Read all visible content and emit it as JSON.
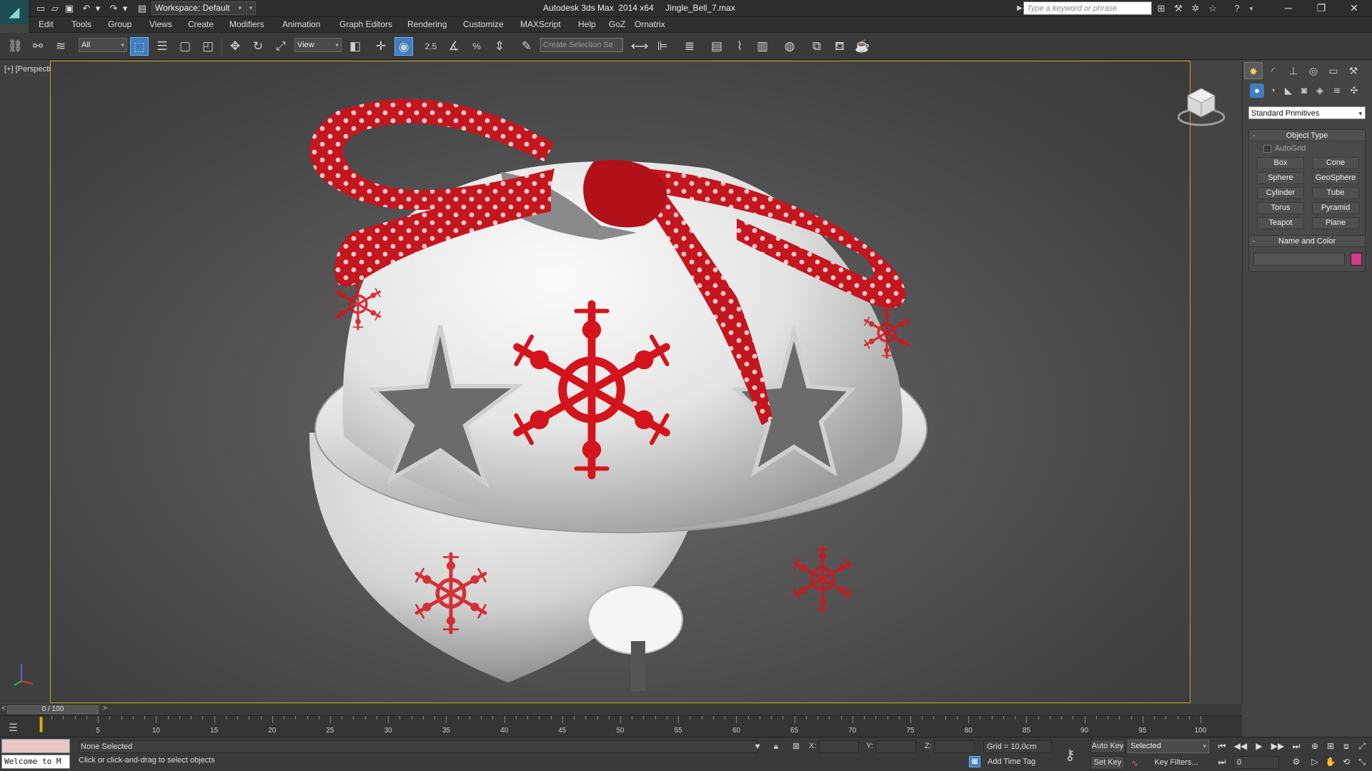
{
  "titlebar": {
    "workspace": "Workspace: Default",
    "title": "Autodesk 3ds Max  2014 x64     Jingle_Bell_7.max",
    "search_placeholder": "Type a keyword or phrase"
  },
  "menu": [
    "Edit",
    "Tools",
    "Group",
    "Views",
    "Create",
    "Modifiers",
    "Animation",
    "Graph Editors",
    "Rendering",
    "Customize",
    "MAXScript",
    "Help",
    "GoZ",
    "Ornatrix"
  ],
  "toolbar": {
    "selection_filter": "All",
    "reference_coord": "View",
    "angle_snap_label": "2.5",
    "named_selection_placeholder": "Create Selection Se"
  },
  "viewport": {
    "label": "[+] [Perspective ] [Shaded ]"
  },
  "command_panel": {
    "category": "Standard Primitives",
    "object_type_title": "Object Type",
    "autogrid": "AutoGrid",
    "primitives": [
      "Box",
      "Cone",
      "Sphere",
      "GeoSphere",
      "Cylinder",
      "Tube",
      "Torus",
      "Pyramid",
      "Teapot",
      "Plane"
    ],
    "name_color_title": "Name and Color",
    "object_color": "#d63a8c"
  },
  "timeline": {
    "slider_label": "0 / 100",
    "ruler_labels": [
      "5",
      "10",
      "15",
      "20",
      "25",
      "30",
      "35",
      "40",
      "45",
      "50",
      "55",
      "60",
      "65",
      "70",
      "75",
      "80",
      "85",
      "90",
      "95",
      "100"
    ]
  },
  "status": {
    "maxscript_output": "Welcome to M",
    "selection": "None Selected",
    "prompt": "Click or click-and-drag to select objects",
    "x_label": "X:",
    "y_label": "Y:",
    "z_label": "Z:",
    "grid": "Grid = 10,0cm",
    "add_time_tag": "Add Time Tag",
    "auto_key": "Auto Key",
    "set_key": "Set Key",
    "key_mode": "Selected",
    "key_filters": "Key Filters...",
    "current_frame": "0"
  },
  "colors": {
    "accent_blue": "#3f7fbf",
    "viewport_border": "#c9a21e",
    "ribbon_red": "#c4161f",
    "bell_white": "#e9e9e9"
  }
}
